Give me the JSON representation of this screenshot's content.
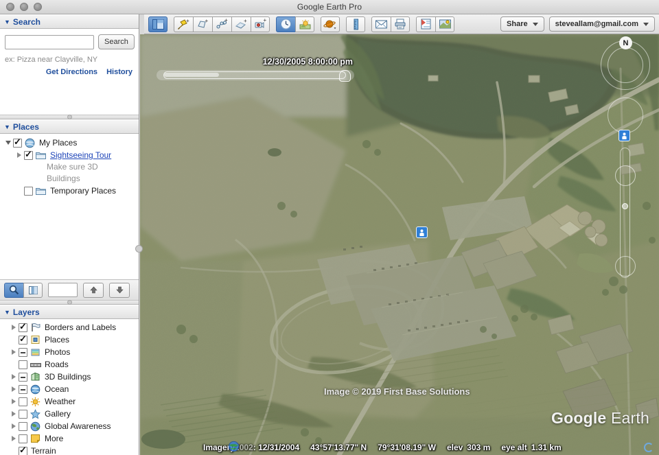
{
  "window": {
    "title": "Google Earth Pro",
    "traffic_lights": [
      "close",
      "minimize",
      "zoom"
    ]
  },
  "toolbar": {
    "groups": [
      {
        "buttons": [
          {
            "name": "toggle-sidebar",
            "icon": "sidebar-icon",
            "active": true
          }
        ]
      },
      {
        "buttons": [
          {
            "name": "add-placemark",
            "icon": "placemark-pin-icon",
            "active": false
          },
          {
            "name": "add-polygon",
            "icon": "polygon-icon",
            "active": false
          },
          {
            "name": "add-path",
            "icon": "path-icon",
            "active": false
          },
          {
            "name": "add-image-overlay",
            "icon": "image-overlay-icon",
            "active": false
          },
          {
            "name": "record-tour",
            "icon": "record-tour-icon",
            "active": false
          }
        ]
      },
      {
        "buttons": [
          {
            "name": "show-historical-imagery",
            "icon": "clock-icon",
            "active": true
          },
          {
            "name": "show-sunlight",
            "icon": "sunlight-icon",
            "active": false
          }
        ]
      },
      {
        "buttons": [
          {
            "name": "switch-to-sky",
            "icon": "planet-icon",
            "active": false
          }
        ]
      },
      {
        "buttons": [
          {
            "name": "show-ruler",
            "icon": "ruler-icon",
            "active": false
          }
        ]
      },
      {
        "buttons": [
          {
            "name": "email",
            "icon": "envelope-icon",
            "active": false
          },
          {
            "name": "print",
            "icon": "printer-icon",
            "active": false
          }
        ]
      },
      {
        "buttons": [
          {
            "name": "save-image",
            "icon": "save-image-icon",
            "active": false
          },
          {
            "name": "view-in-maps",
            "icon": "view-in-maps-icon",
            "active": false
          }
        ]
      }
    ],
    "share_label": "Share",
    "account_label": "steveallam@gmail.com"
  },
  "search": {
    "header": "Search",
    "input_value": "",
    "input_placeholder": "",
    "button_label": "Search",
    "hint": "ex: Pizza near Clayville, NY",
    "get_directions_label": "Get Directions",
    "history_label": "History"
  },
  "places": {
    "header": "Places",
    "items": [
      {
        "label": "My Places",
        "indent": 0,
        "twisty": "open",
        "checkbox": "checked",
        "icon": "globe-icon",
        "link": false
      },
      {
        "label": "Sightseeing Tour",
        "indent": 1,
        "twisty": "closed",
        "checkbox": "checked",
        "icon": "folder-icon",
        "link": true
      },
      {
        "label": "Temporary Places",
        "indent": 0,
        "twisty": "none",
        "checkbox": "unchecked",
        "icon": "folder-icon",
        "link": false
      }
    ],
    "sub_note_line1": "Make sure 3D",
    "sub_note_line2": "Buildings",
    "footer": {
      "search_places_icon": "magnifier-icon",
      "view_mode_icon": "split-view-icon",
      "filter_value": "",
      "up_label": "▲",
      "down_label": "▼"
    }
  },
  "layers": {
    "header": "Layers",
    "items": [
      {
        "label": "Borders and Labels",
        "twisty": "closed",
        "checkbox": "checked",
        "icon": "borders-labels-icon"
      },
      {
        "label": "Places",
        "twisty": "none",
        "checkbox": "checked",
        "icon": "places-marker-icon"
      },
      {
        "label": "Photos",
        "twisty": "closed",
        "checkbox": "partial",
        "icon": "photos-icon"
      },
      {
        "label": "Roads",
        "twisty": "none",
        "checkbox": "unchecked",
        "icon": "roads-icon"
      },
      {
        "label": "3D Buildings",
        "twisty": "closed",
        "checkbox": "partial",
        "icon": "buildings-icon"
      },
      {
        "label": "Ocean",
        "twisty": "closed",
        "checkbox": "partial",
        "icon": "ocean-globe-icon"
      },
      {
        "label": "Weather",
        "twisty": "closed",
        "checkbox": "unchecked",
        "icon": "weather-sun-icon"
      },
      {
        "label": "Gallery",
        "twisty": "closed",
        "checkbox": "unchecked",
        "icon": "gallery-star-icon"
      },
      {
        "label": "Global Awareness",
        "twisty": "closed",
        "checkbox": "unchecked",
        "icon": "globe-awareness-icon"
      },
      {
        "label": "More",
        "twisty": "closed",
        "checkbox": "unchecked",
        "icon": "more-note-icon"
      },
      {
        "label": "Terrain",
        "twisty": "none",
        "checkbox": "checked",
        "icon": "none"
      }
    ]
  },
  "map": {
    "time_slider": {
      "date": "12/30/2005",
      "time": "8:00:00 pm",
      "label": "12/30/2005   8:00:00 pm",
      "handle_position_pct": 95
    },
    "nav": {
      "north_label": "N",
      "pegman_icon": "street-view-pegman-icon"
    },
    "image_credit": "Image © 2019 First Base Solutions",
    "watermark_google": "Google",
    "watermark_earth": " Earth"
  },
  "status_bar": {
    "imagery_label": "Imagery",
    "imagery_faded_year": "2002",
    "imagery_date": ": 12/31/2004",
    "latitude": "43°57'13.77\" N",
    "longitude": "79°31'08.19\" W",
    "elev_label": "elev",
    "elev_value": "303 m",
    "eye_alt_label": "eye alt",
    "eye_alt_value": "1.31 km"
  },
  "colors": {
    "accent_blue": "#1f4e9c",
    "active_button": "#4b7fc0",
    "link_blue": "#1d44b8",
    "pegman_blue": "#2f7fd6"
  }
}
